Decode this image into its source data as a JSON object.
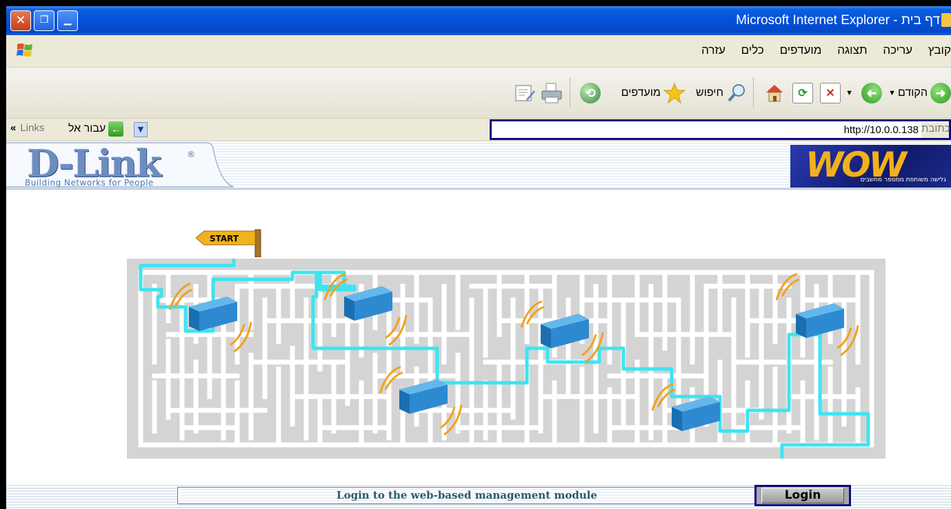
{
  "window": {
    "title": "Microsoft Internet Explorer - דף בית"
  },
  "menu": {
    "items": [
      "קובץ",
      "עריכה",
      "תצוגה",
      "מועדפים",
      "כלים",
      "עזרה"
    ]
  },
  "toolbar": {
    "back_label": "הקודם",
    "search_label": "חיפוש",
    "favorites_label": "מועדפים"
  },
  "addressbar": {
    "label": "כתובת",
    "url": "http://10.0.0.138",
    "go_label": "עבור אל",
    "links_label": "Links",
    "chevron": "«"
  },
  "header": {
    "logo_text": "D-Link",
    "logo_reg": "®",
    "tagline": "Building Networks for People",
    "wow_text": "WOW",
    "wow_subtitle": "גלישה משותפת ממספר מחשבים"
  },
  "maze": {
    "start_label": "START"
  },
  "footer": {
    "message": "Login to the web-based management module",
    "login_label": "Login"
  }
}
